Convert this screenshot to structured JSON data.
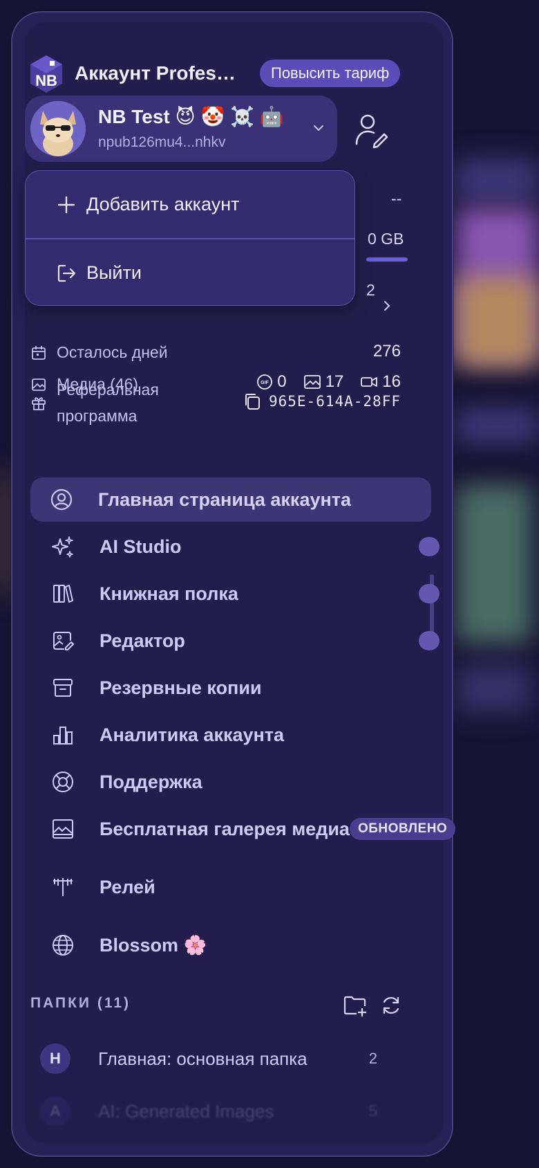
{
  "header": {
    "logo_text": "NB",
    "account_title": "Аккаунт Professional",
    "upgrade_label": "Повысить тариф"
  },
  "user": {
    "name": "NB Test 😈 🤡 ☠️ 🤖",
    "npub": "npub126mu4...nhkv"
  },
  "behind_dropdown": {
    "row1_value": "--",
    "storage_value": "0 GB",
    "row3_value": "2"
  },
  "dropdown": {
    "items": [
      {
        "label": "Добавить аккаунт",
        "icon": "plus-icon"
      },
      {
        "label": "Выйти",
        "icon": "logout-icon"
      }
    ]
  },
  "stats": {
    "days_left_label": "Осталось дней",
    "days_left_value": "276",
    "media_label": "Медиа (46)",
    "gif_count": "0",
    "image_count": "17",
    "video_count": "16",
    "referral_label": "Реферальная программа",
    "referral_code": "965E-614A-28FF"
  },
  "nav": {
    "items": [
      {
        "label": "Главная страница аккаунта",
        "icon": "user-circle-icon",
        "active": true
      },
      {
        "label": "AI Studio",
        "icon": "sparkles-icon"
      },
      {
        "label": "Книжная полка",
        "icon": "books-icon"
      },
      {
        "label": "Редактор",
        "icon": "image-edit-icon"
      },
      {
        "label": "Резервные копии",
        "icon": "archive-icon"
      },
      {
        "label": "Аналитика аккаунта",
        "icon": "bar-chart-icon"
      },
      {
        "label": "Поддержка",
        "icon": "lifebuoy-icon"
      },
      {
        "label": "Бесплатная галерея медиа",
        "icon": "gallery-icon",
        "badge": "ОБНОВЛЕНО"
      },
      {
        "label": "Релей",
        "icon": "antenna-icon"
      },
      {
        "label": "Blossom 🌸",
        "icon": "globe-icon"
      }
    ]
  },
  "folders": {
    "header": "ПАПКИ (11)",
    "items": [
      {
        "avatar": "H",
        "label": "Главная: основная папка",
        "count": "2"
      },
      {
        "avatar": "A",
        "label": "AI: Generated Images",
        "count": "5"
      }
    ]
  },
  "colors": {
    "panel_bg": "#231d4d",
    "accent": "#5c4cb8",
    "text_primary": "#f1eeff",
    "text_secondary": "#c5bfed"
  }
}
